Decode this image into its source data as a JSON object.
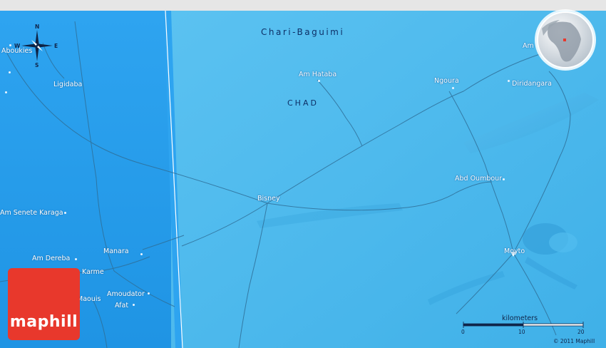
{
  "region_name": "Chari-Baguimi",
  "country_name": "CHAD",
  "places": [
    {
      "name": "Aboukies"
    },
    {
      "name": "Ligidaba"
    },
    {
      "name": "Am Hataba"
    },
    {
      "name": "Ngoura"
    },
    {
      "name": "Diridangara"
    },
    {
      "name": "Am"
    },
    {
      "name": "Bisney"
    },
    {
      "name": "Abd Oumbour"
    },
    {
      "name": "Am Senete Karaga"
    },
    {
      "name": "Manara"
    },
    {
      "name": "Am Dereba"
    },
    {
      "name": "Karme"
    },
    {
      "name": "Maouis"
    },
    {
      "name": "Amoudator"
    },
    {
      "name": "Afat"
    },
    {
      "name": "Moyto"
    }
  ],
  "compass": {
    "north": "N",
    "south": "S",
    "east": "E",
    "west": "W"
  },
  "scale": {
    "title": "kilometers",
    "ticks": [
      "0",
      "10",
      "20"
    ]
  },
  "logo_text": "maphill",
  "copyright": "© 2011 Maphill",
  "colors": {
    "left_panel": "#2aa0ee",
    "right_panel": "#4cb8ec",
    "logo": "#e8382c",
    "label_dark": "#0d2f66",
    "road": "#2f6f98"
  }
}
